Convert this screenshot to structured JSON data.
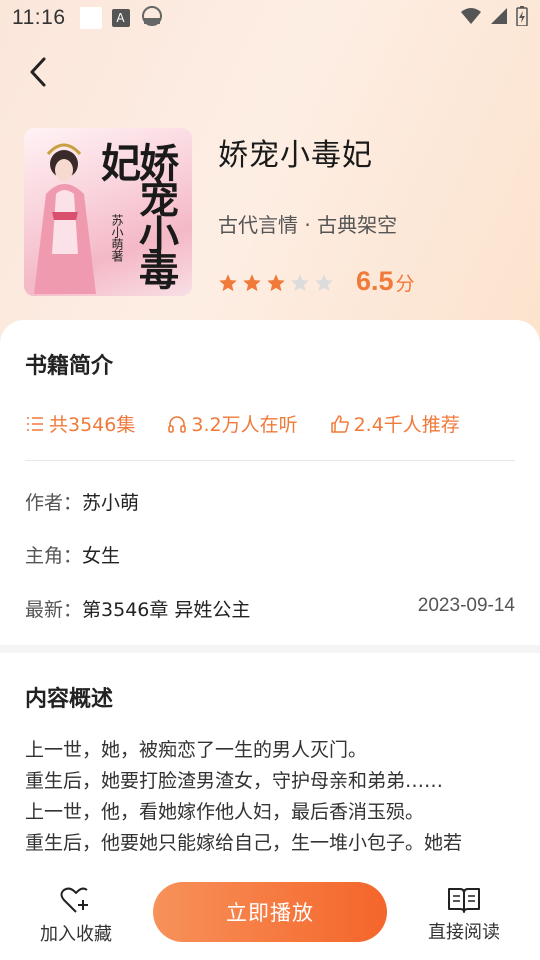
{
  "status_bar": {
    "time": "11:16",
    "icons": [
      "notification-square-icon",
      "a-keyboard-icon",
      "cloud-sync-icon",
      "wifi-icon",
      "signal-icon",
      "battery-icon"
    ]
  },
  "book": {
    "title": "娇宠小毒妃",
    "genre": "古代言情 · 古典架空",
    "rating": {
      "stars_filled": 3,
      "stars_total": 5,
      "score": "6.5",
      "unit": "分"
    },
    "cover": {
      "title_text": "娇宠小毒妃",
      "author_text": "苏小萌著"
    }
  },
  "intro": {
    "title": "书籍简介",
    "stats": [
      {
        "icon": "list-icon",
        "text": "共3546集"
      },
      {
        "icon": "headphones-icon",
        "text": "3.2万人在听"
      },
      {
        "icon": "thumbs-up-icon",
        "text": "2.4千人推荐"
      }
    ],
    "author_label": "作者：",
    "author": "苏小萌",
    "protagonist_label": "主角：",
    "protagonist": "女生",
    "latest_label": "最新：",
    "latest_chapter": "第3546章 异姓公主",
    "latest_date": "2023-09-14"
  },
  "summary": {
    "title": "内容概述",
    "text": "上一世，她，被痴恋了一生的男人灭门。\n重生后，她要打脸渣男渣女，守护母亲和弟弟……\n上一世，他，看她嫁作他人妇，最后香消玉殒。\n重生后，他要她只能嫁给自己，生一堆小包子。她若"
  },
  "actions": {
    "favorite": "加入收藏",
    "play": "立即播放",
    "read": "直接阅读"
  },
  "colors": {
    "accent": "#f07a3a",
    "play_gradient_start": "#f6925a",
    "play_gradient_end": "#f5652a",
    "star_empty": "#dcdcdc"
  }
}
